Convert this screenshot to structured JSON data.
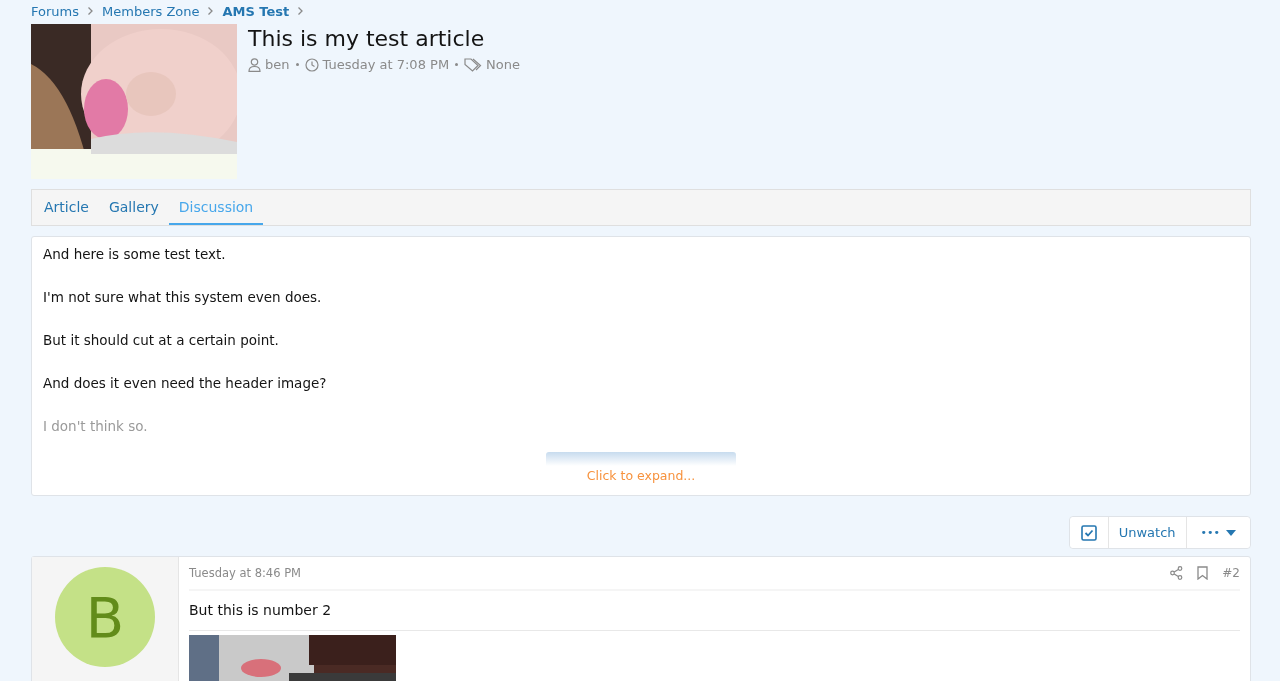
{
  "breadcrumb": [
    {
      "label": "Forums",
      "current": false
    },
    {
      "label": "Members Zone",
      "current": false
    },
    {
      "label": "AMS Test",
      "current": true
    }
  ],
  "article": {
    "title": "This is my test article",
    "author": "ben",
    "date": "Tuesday at 7:08 PM",
    "tags": "None"
  },
  "tabs": [
    {
      "label": "Article",
      "selected": false
    },
    {
      "label": "Gallery",
      "selected": false
    },
    {
      "label": "Discussion",
      "selected": true
    }
  ],
  "body": {
    "paragraphs": [
      {
        "text": "And here is some test text.",
        "faded": false
      },
      {
        "text": "I'm not sure what this system even does.",
        "faded": false
      },
      {
        "text": "But it should cut at a certain point.",
        "faded": false
      },
      {
        "text": "And does it even need the header image?",
        "faded": false
      },
      {
        "text": "I don't think so.",
        "faded": true
      }
    ],
    "expand_link": "Click to expand..."
  },
  "watch_bar": {
    "watched": true,
    "unwatch_button": "Unwatch",
    "more_button": "•••"
  },
  "post": {
    "avatar_letter": "B",
    "date": "Tuesday at 8:46 PM",
    "number": "#2",
    "text": "But this is number 2"
  }
}
